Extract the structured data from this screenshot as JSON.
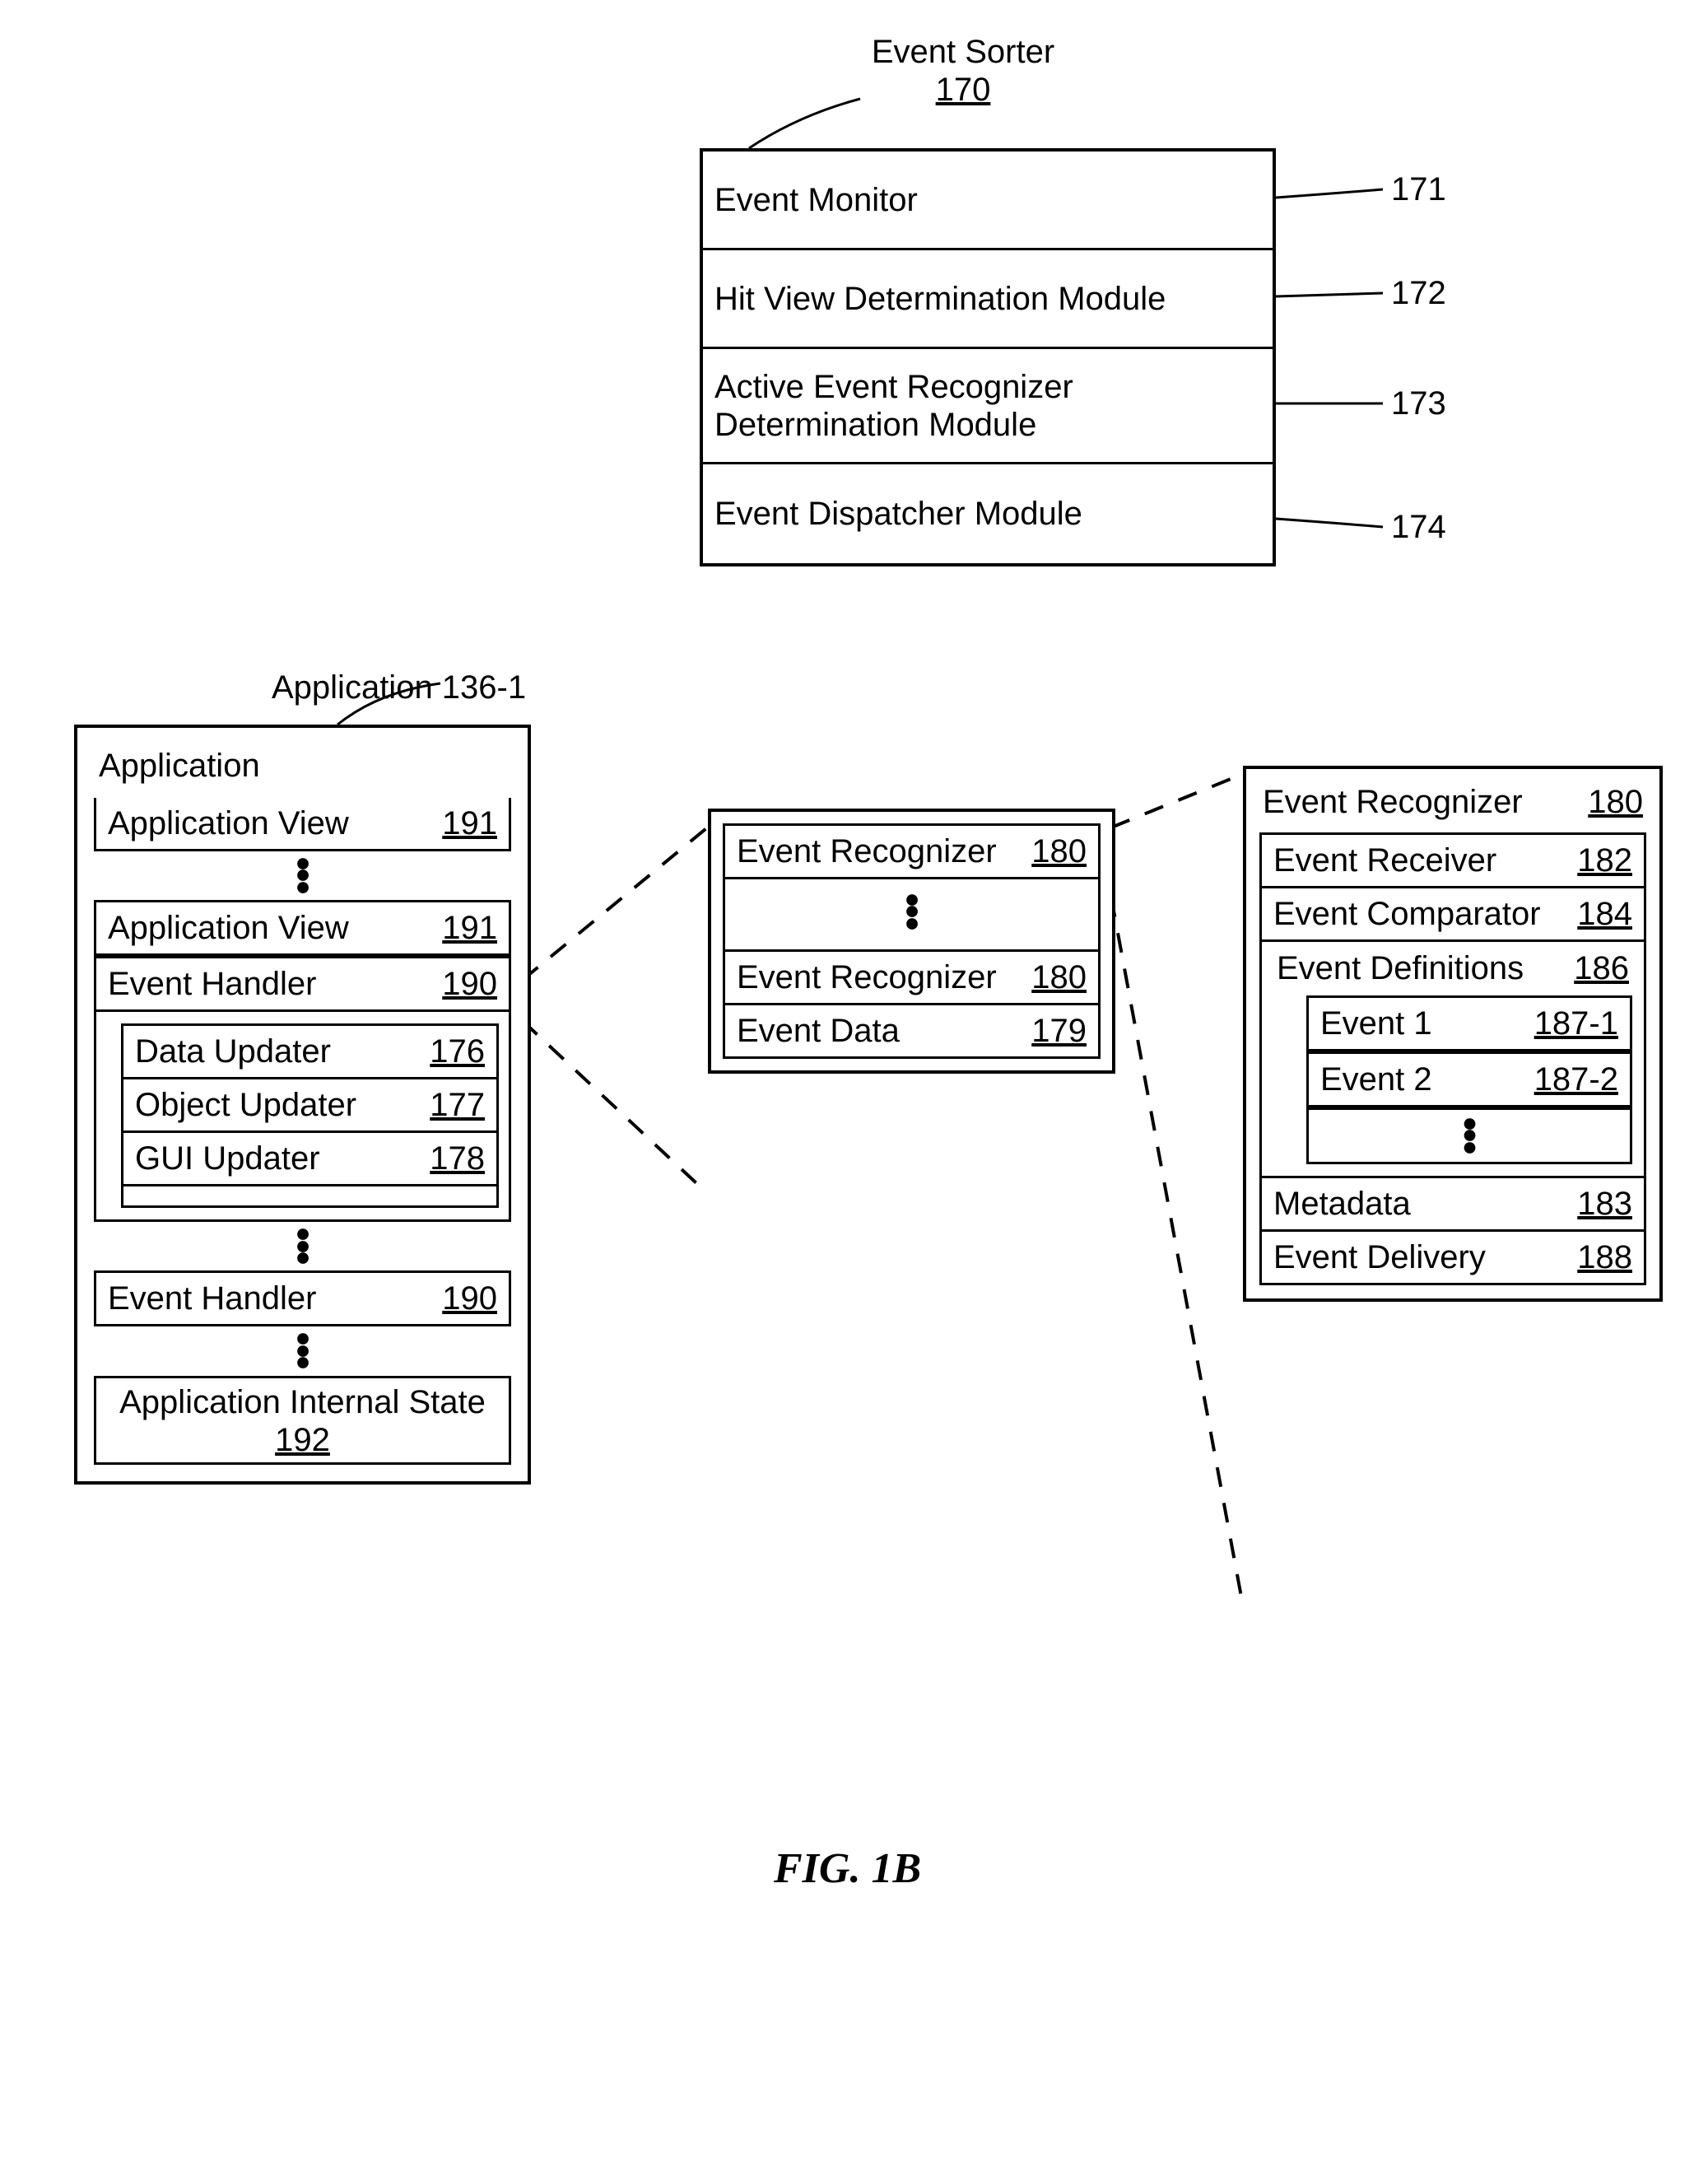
{
  "figure_caption": "FIG. 1B",
  "event_sorter": {
    "title": "Event Sorter",
    "ref": "170",
    "rows": [
      {
        "label": "Event Monitor",
        "num": "171"
      },
      {
        "label": "Hit View Determination Module",
        "num": "172"
      },
      {
        "label": "Active Event Recognizer Determination Module",
        "num": "173"
      },
      {
        "label": "Event Dispatcher Module",
        "num": "174"
      }
    ]
  },
  "application": {
    "id_label": "Application 136-1",
    "title": "Application",
    "view1": {
      "label": "Application View",
      "ref": "191"
    },
    "view2": {
      "label": "Application View",
      "ref": "191"
    },
    "handler1": {
      "label": "Event Handler",
      "ref": "190",
      "data": {
        "label": "Data Updater",
        "ref": "176"
      },
      "object": {
        "label": "Object Updater",
        "ref": "177"
      },
      "gui": {
        "label": "GUI Updater",
        "ref": "178"
      }
    },
    "handler2": {
      "label": "Event Handler",
      "ref": "190"
    },
    "internal_state": {
      "label": "Application Internal State",
      "ref": "192"
    }
  },
  "middle": {
    "rec1": {
      "label": "Event Recognizer",
      "ref": "180"
    },
    "rec2": {
      "label": "Event Recognizer",
      "ref": "180"
    },
    "data": {
      "label": "Event Data",
      "ref": "179"
    }
  },
  "recognizer_detail": {
    "title": {
      "label": "Event Recognizer",
      "ref": "180"
    },
    "receiver": {
      "label": "Event Receiver",
      "ref": "182"
    },
    "comparator": {
      "label": "Event Comparator",
      "ref": "184"
    },
    "defs": {
      "label": "Event Definitions",
      "ref": "186",
      "e1": {
        "label": "Event 1",
        "ref": "187-1"
      },
      "e2": {
        "label": "Event 2",
        "ref": "187-2"
      }
    },
    "metadata": {
      "label": "Metadata",
      "ref": "183"
    },
    "delivery": {
      "label": "Event Delivery",
      "ref": "188"
    }
  }
}
